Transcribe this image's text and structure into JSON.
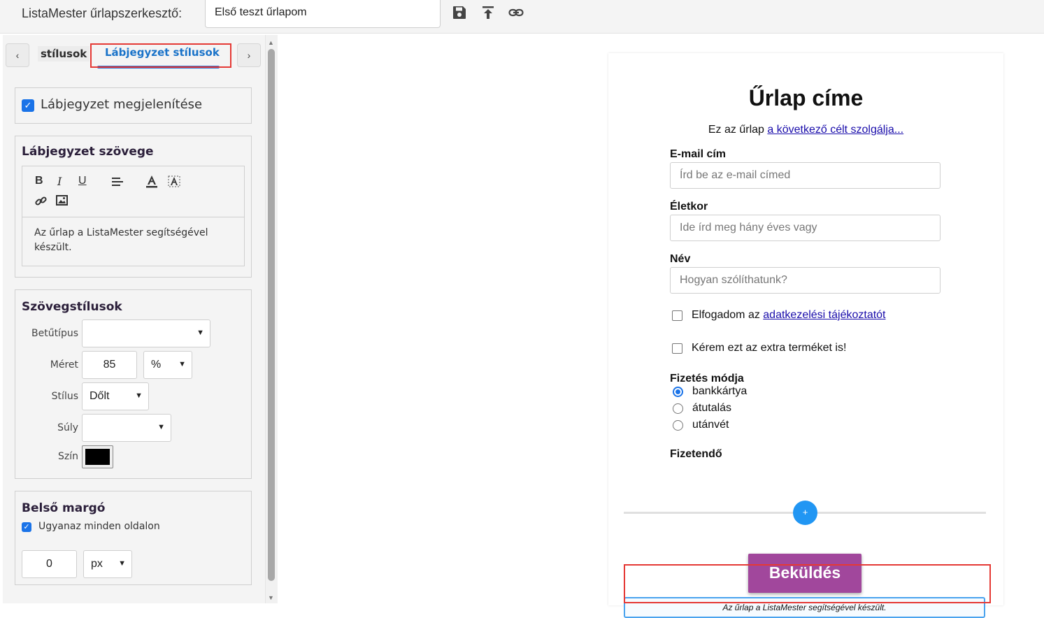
{
  "header": {
    "app_title": "ListaMester űrlapszerkesztő:",
    "form_name": "Első teszt űrlapom",
    "icons": [
      "save-icon",
      "upload-icon",
      "link-icon"
    ]
  },
  "tabs": {
    "prev_arrow": "‹",
    "next_arrow": "›",
    "inactive": "stílusok",
    "active": "Lábjegyzet stílusok"
  },
  "footer_settings": {
    "show_footer_label": "Lábjegyzet megjelenítése",
    "show_footer_checked": true,
    "text_section_title": "Lábjegyzet szövege",
    "toolbar": [
      "B",
      "I",
      "U"
    ],
    "footer_text": "Az űrlap a ListaMester segítségével készült."
  },
  "text_styles": {
    "title": "Szövegstílusok",
    "font_label": "Betűtípus",
    "font_value": "",
    "size_label": "Méret",
    "size_value": "85",
    "size_unit": "%",
    "style_label": "Stílus",
    "style_value": "Dőlt",
    "weight_label": "Súly",
    "weight_value": "",
    "color_label": "Szín",
    "color_value": "#000000"
  },
  "padding": {
    "title": "Belső margó",
    "same_all_label": "Ugyanaz minden oldalon",
    "same_all_checked": true,
    "value": "0",
    "unit": "px"
  },
  "form": {
    "title": "Űrlap címe",
    "subtitle_prefix": "Ez az űrlap ",
    "subtitle_link": "a következő célt szolgálja...",
    "fields": [
      {
        "label": "E-mail cím",
        "placeholder": "Írd be az e-mail címed"
      },
      {
        "label": "Életkor",
        "placeholder": "Ide írd meg hány éves vagy"
      },
      {
        "label": "Név",
        "placeholder": "Hogyan szólíthatunk?"
      }
    ],
    "consent_prefix": "Elfogadom az ",
    "consent_link": "adatkezelési tájékoztatót",
    "extra_product": "Kérem ezt az extra terméket is!",
    "payment_label": "Fizetés módja",
    "payment_options": [
      "bankkártya",
      "átutalás",
      "utánvét"
    ],
    "payment_selected": "bankkártya",
    "payable_label": "Fizetendő",
    "add_button": "+",
    "submit_label": "Beküldés",
    "footer_text": "Az űrlap a ListaMester segítségével készült."
  },
  "colors": {
    "accent_blue": "#1a73e8",
    "submit_purple": "#a1479c",
    "highlight_red": "#e53935"
  }
}
